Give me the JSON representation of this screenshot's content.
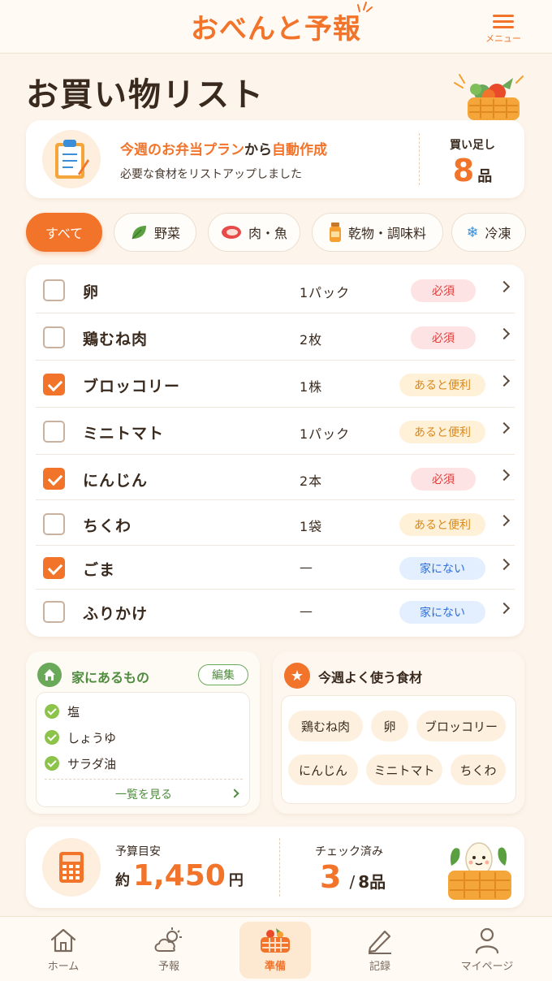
{
  "header": {
    "logo": "おべんと予報",
    "menu_label": "メニュー"
  },
  "page_title": "お買い物リスト",
  "info": {
    "highlight1": "今週のお弁当プラン",
    "connector": "から",
    "highlight2": "自動作成",
    "subtext": "必要な食材をリストアップしました",
    "extra_label": "買い足し",
    "extra_count": "8",
    "extra_unit": "品"
  },
  "filters": [
    {
      "label": "すべて",
      "active": true,
      "icon": "none"
    },
    {
      "label": "野菜",
      "active": false,
      "icon": "leaf-icon"
    },
    {
      "label": "肉・魚",
      "active": false,
      "icon": "meat-icon"
    },
    {
      "label": "乾物・調味料",
      "active": false,
      "icon": "jar-icon"
    },
    {
      "label": "冷凍",
      "active": false,
      "icon": "snowflake-icon"
    }
  ],
  "items": [
    {
      "name": "卵",
      "qty": "1パック",
      "tag": "必須",
      "tag_type": "req",
      "checked": false
    },
    {
      "name": "鶏むね肉",
      "qty": "2枚",
      "tag": "必須",
      "tag_type": "req",
      "checked": false
    },
    {
      "name": "ブロッコリー",
      "qty": "1株",
      "tag": "あると便利",
      "tag_type": "nice",
      "checked": true
    },
    {
      "name": "ミニトマト",
      "qty": "1パック",
      "tag": "あると便利",
      "tag_type": "nice",
      "checked": false
    },
    {
      "name": "にんじん",
      "qty": "2本",
      "tag": "必須",
      "tag_type": "req",
      "checked": true
    },
    {
      "name": "ちくわ",
      "qty": "1袋",
      "tag": "あると便利",
      "tag_type": "nice",
      "checked": false
    },
    {
      "name": "ごま",
      "qty": "—",
      "tag": "家にない",
      "tag_type": "none",
      "checked": true
    },
    {
      "name": "ふりかけ",
      "qty": "—",
      "tag": "家にない",
      "tag_type": "none",
      "checked": false
    }
  ],
  "home": {
    "title": "家にあるもの",
    "edit_label": "編集",
    "items": [
      "塩",
      "しょうゆ",
      "サラダ油"
    ],
    "view_all": "一覧を見る"
  },
  "frequent": {
    "title": "今週よく使う食材",
    "items": [
      "鶏むね肉",
      "卵",
      "ブロッコリー",
      "にんじん",
      "ミニトマト",
      "ちくわ"
    ]
  },
  "budget": {
    "label": "予算目安",
    "prefix": "約",
    "amount": "1,450",
    "unit": "円",
    "check_label": "チェック済み",
    "checked": "3",
    "separator": "/",
    "total": "8品"
  },
  "nav": [
    {
      "label": "ホーム",
      "icon": "home-icon",
      "active": false
    },
    {
      "label": "予報",
      "icon": "weather-icon",
      "active": false
    },
    {
      "label": "準備",
      "icon": "basket-icon",
      "active": true
    },
    {
      "label": "記録",
      "icon": "pencil-icon",
      "active": false
    },
    {
      "label": "マイページ",
      "icon": "user-icon",
      "active": false
    }
  ],
  "colors": {
    "accent": "#f2742a",
    "background": "#fdf5ec",
    "green": "#6aa85a"
  }
}
